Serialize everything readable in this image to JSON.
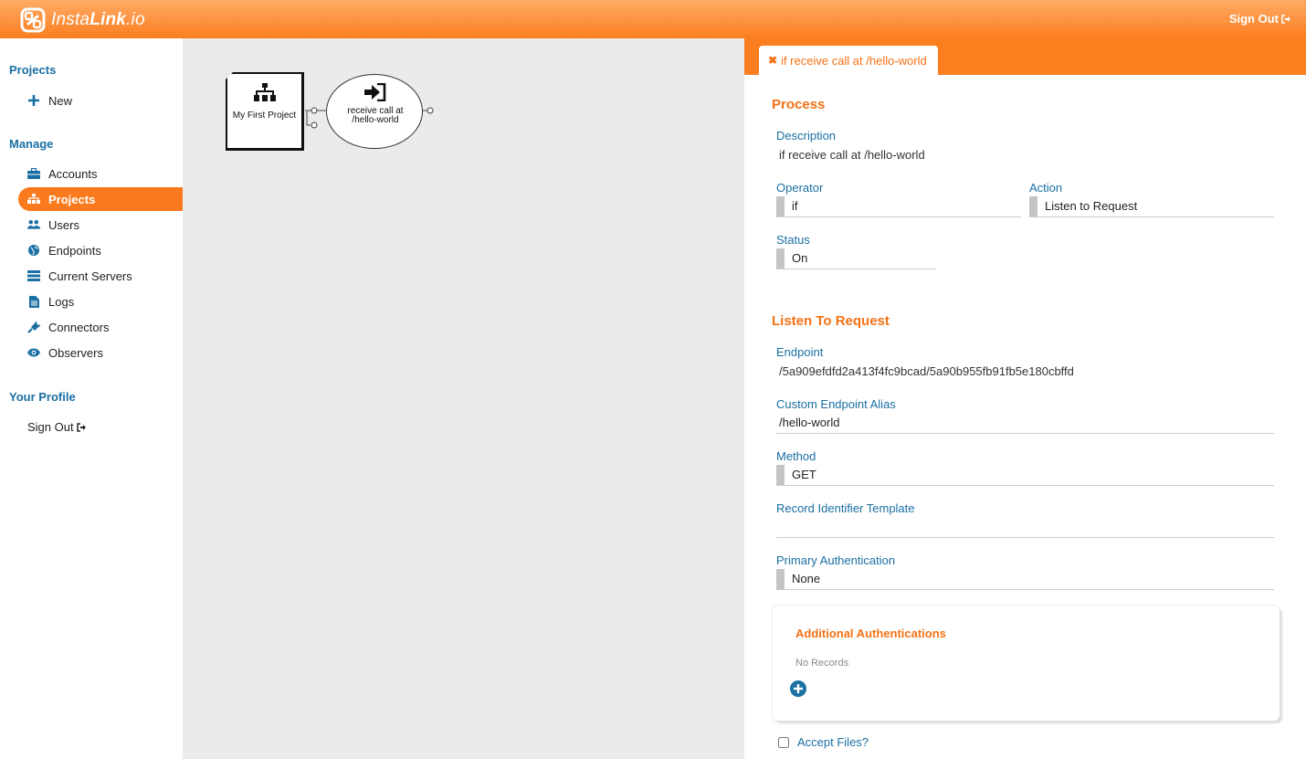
{
  "brand": {
    "name_light": "Insta",
    "name_bold": "Link",
    "name_suffix": ".io"
  },
  "header": {
    "signout_label": "Sign Out"
  },
  "sidebar": {
    "projects_heading": "Projects",
    "new_label": "New",
    "manage_heading": "Manage",
    "items": [
      {
        "label": "Accounts",
        "icon": "briefcase-icon"
      },
      {
        "label": "Projects",
        "icon": "sitemap-icon",
        "active": true
      },
      {
        "label": "Users",
        "icon": "users-icon"
      },
      {
        "label": "Endpoints",
        "icon": "globe-icon"
      },
      {
        "label": "Current Servers",
        "icon": "server-icon"
      },
      {
        "label": "Logs",
        "icon": "file-icon"
      },
      {
        "label": "Connectors",
        "icon": "plug-icon"
      },
      {
        "label": "Observers",
        "icon": "eye-icon"
      }
    ],
    "profile_heading": "Your Profile",
    "signout_label": "Sign Out"
  },
  "canvas": {
    "project_node_label": "My First Project",
    "trigger_node_label_line1": "receive call at",
    "trigger_node_label_line2": "/hello-world"
  },
  "panel": {
    "tab_label": "if receive call at /hello-world",
    "process": {
      "title": "Process",
      "description_label": "Description",
      "description_value": "if receive call at /hello-world",
      "operator_label": "Operator",
      "operator_value": "if",
      "action_label": "Action",
      "action_value": "Listen to Request",
      "status_label": "Status",
      "status_value": "On"
    },
    "listen": {
      "title": "Listen To Request",
      "endpoint_label": "Endpoint",
      "endpoint_value": "/5a909efdfd2a413f4fc9bcad/5a90b955fb91fb5e180cbffd",
      "alias_label": "Custom Endpoint Alias",
      "alias_value": "/hello-world",
      "method_label": "Method",
      "method_value": "GET",
      "record_label": "Record Identifier Template",
      "record_value": "",
      "auth_label": "Primary Authentication",
      "auth_value": "None"
    },
    "additional": {
      "title": "Additional Authentications",
      "empty_text": "No Records"
    },
    "accept_files_label": "Accept Files?"
  },
  "colors": {
    "accent": "#fb7e1f",
    "link": "#1a6fa3",
    "canvas_bg": "#ebebeb"
  }
}
